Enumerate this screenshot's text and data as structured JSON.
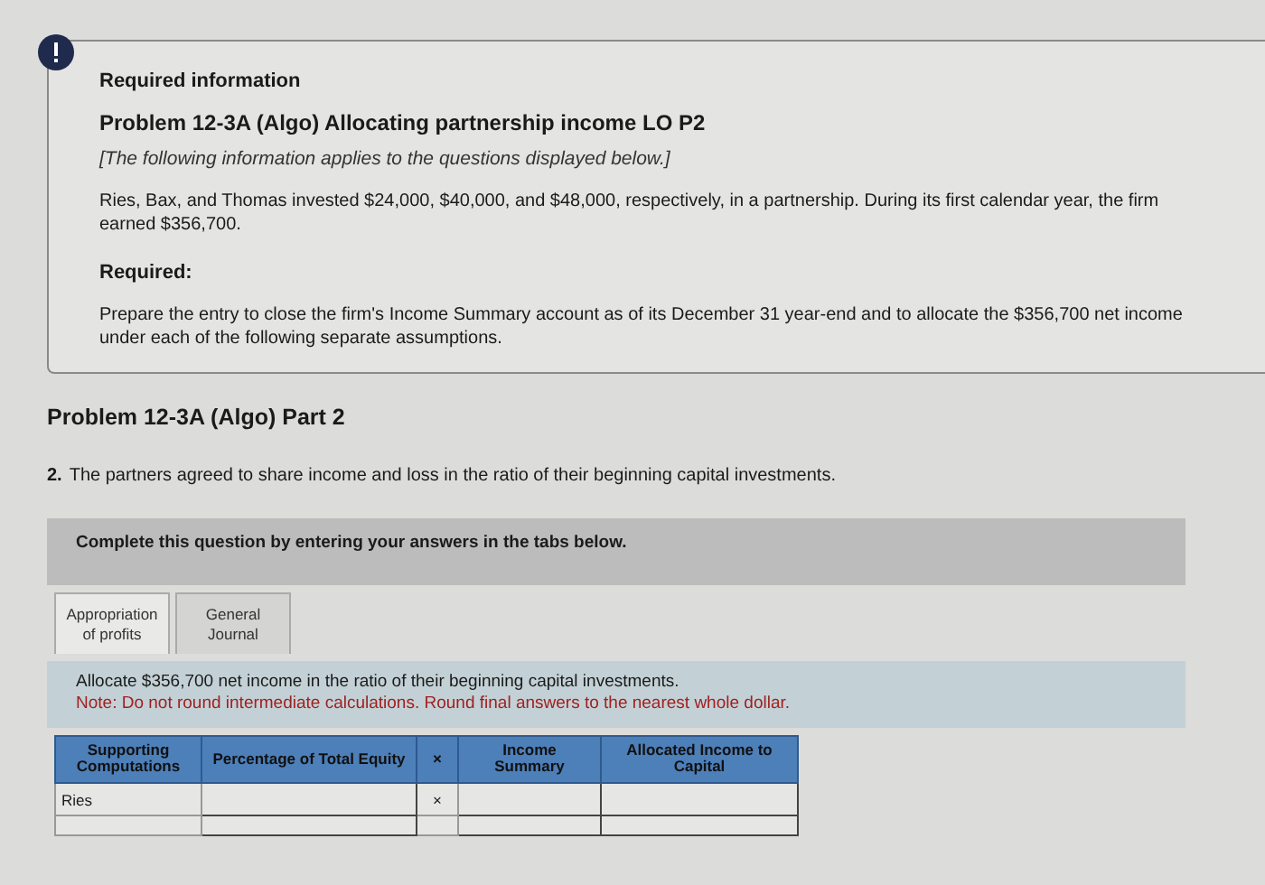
{
  "info_card": {
    "heading": "Required information",
    "title": "Problem 12-3A (Algo) Allocating partnership income LO P2",
    "note": "[The following information applies to the questions displayed below.]",
    "body": "Ries, Bax, and Thomas invested $24,000, $40,000, and $48,000, respectively, in a partnership. During its first calendar year, the firm earned $356,700.",
    "required_label": "Required:",
    "required_text": "Prepare the entry to close the firm's Income Summary account as of its December 31 year-end and to allocate the $356,700 net income under each of the following separate assumptions."
  },
  "part": {
    "title": "Problem 12-3A (Algo) Part 2",
    "question_number": "2.",
    "question": "The partners agreed to share income and loss in the ratio of their beginning capital investments."
  },
  "instruction": "Complete this question by entering your answers in the tabs below.",
  "tabs": [
    {
      "label": "Appropriation of profits",
      "selected": true
    },
    {
      "label": "General Journal",
      "selected": false
    }
  ],
  "task": {
    "text": "Allocate $356,700 net income in the ratio of their beginning capital investments.",
    "note": "Note: Do not round intermediate calculations. Round final answers to the nearest whole dollar."
  },
  "table": {
    "columns": [
      "Supporting Computations",
      "Percentage of Total Equity",
      "×",
      "Income Summary",
      "Allocated Income to Capital"
    ],
    "rows": [
      {
        "label": "Ries",
        "operator": "×"
      }
    ]
  }
}
